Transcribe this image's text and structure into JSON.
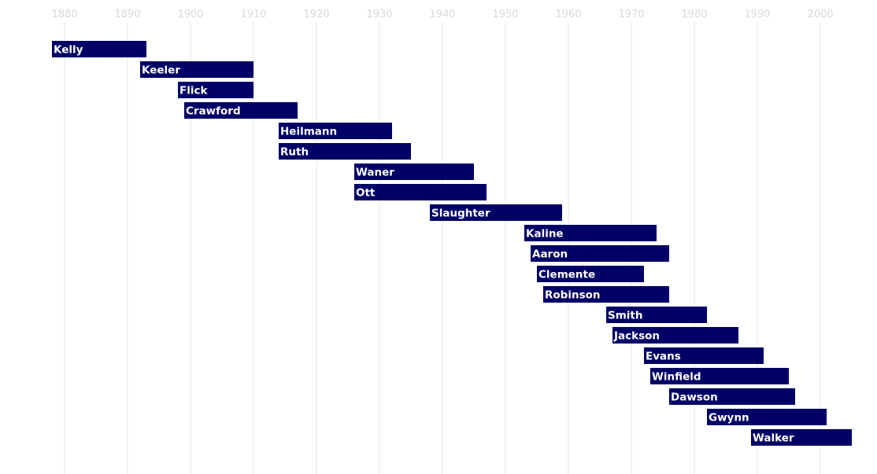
{
  "chart_data": {
    "type": "timeline",
    "title": "",
    "xlabel": "",
    "ylabel": "",
    "xlim": [
      1880,
      2000
    ],
    "x_ticks": [
      1880,
      1890,
      1900,
      1910,
      1920,
      1930,
      1940,
      1950,
      1960,
      1970,
      1980,
      1990,
      2000
    ],
    "grid": true,
    "bar_color": "#000066",
    "grid_color": "#ebebeb",
    "tick_color": "#d9d9d9",
    "series": [
      {
        "name": "Kelly",
        "start": 1878,
        "end": 1893
      },
      {
        "name": "Keeler",
        "start": 1892,
        "end": 1910
      },
      {
        "name": "Flick",
        "start": 1898,
        "end": 1910
      },
      {
        "name": "Crawford",
        "start": 1899,
        "end": 1917
      },
      {
        "name": "Heilmann",
        "start": 1914,
        "end": 1932
      },
      {
        "name": "Ruth",
        "start": 1914,
        "end": 1935
      },
      {
        "name": "Waner",
        "start": 1926,
        "end": 1945
      },
      {
        "name": "Ott",
        "start": 1926,
        "end": 1947
      },
      {
        "name": "Slaughter",
        "start": 1938,
        "end": 1959
      },
      {
        "name": "Kaline",
        "start": 1953,
        "end": 1974
      },
      {
        "name": "Aaron",
        "start": 1954,
        "end": 1976
      },
      {
        "name": "Clemente",
        "start": 1955,
        "end": 1972
      },
      {
        "name": "Robinson",
        "start": 1956,
        "end": 1976
      },
      {
        "name": "Smith",
        "start": 1966,
        "end": 1982
      },
      {
        "name": "Jackson",
        "start": 1967,
        "end": 1987
      },
      {
        "name": "Evans",
        "start": 1972,
        "end": 1991
      },
      {
        "name": "Winfield",
        "start": 1973,
        "end": 1995
      },
      {
        "name": "Dawson",
        "start": 1976,
        "end": 1996
      },
      {
        "name": "Gwynn",
        "start": 1982,
        "end": 2001
      },
      {
        "name": "Walker",
        "start": 1989,
        "end": 2005
      }
    ]
  }
}
